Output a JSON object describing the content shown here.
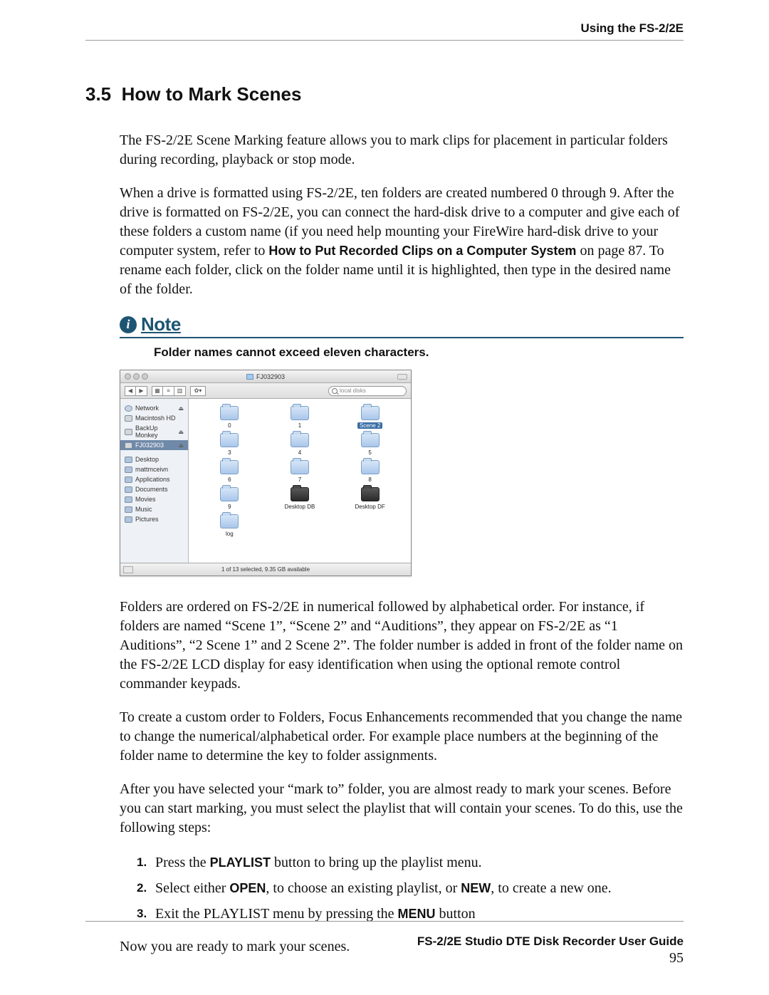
{
  "running_head": "Using the FS-2/2E",
  "section": {
    "number": "3.5",
    "title": "How to Mark Scenes"
  },
  "para1": "The FS-2/2E Scene Marking feature allows you to mark clips for placement in particular folders during recording, playback or stop mode.",
  "para2a": "When a drive is formatted using FS-2/2E, ten folders are created numbered 0 through 9. After the drive is formatted on FS-2/2E, you can connect the hard-disk drive to a computer and give each of these folders a custom name (if you need help mounting your FireWire hard-disk drive to your computer system, refer to ",
  "para2b_bold": "How to Put Recorded Clips on a Computer System",
  "para2c": " on page 87. To rename each folder, click on the folder name until it is highlighted, then type in the desired name of the folder.",
  "note": {
    "label": "Note",
    "text": "Folder names cannot exceed eleven characters."
  },
  "finder": {
    "title": "FJ032903",
    "search_placeholder": "local disks",
    "sidebar": [
      {
        "label": "Network",
        "kind": "network",
        "eject": "⏏"
      },
      {
        "label": "Macintosh HD",
        "kind": "hd"
      },
      {
        "label": "BackUp Monkey",
        "kind": "hd",
        "eject": "⏏"
      },
      {
        "label": "FJ032903",
        "kind": "hd",
        "selected": true,
        "eject": "⏏"
      },
      {
        "sep": true
      },
      {
        "label": "Desktop",
        "kind": "folder"
      },
      {
        "label": "mattmceivn",
        "kind": "home"
      },
      {
        "label": "Applications",
        "kind": "apps"
      },
      {
        "label": "Documents",
        "kind": "folder"
      },
      {
        "label": "Movies",
        "kind": "movies"
      },
      {
        "label": "Music",
        "kind": "music"
      },
      {
        "label": "Pictures",
        "kind": "pictures"
      }
    ],
    "items": [
      {
        "label": "0"
      },
      {
        "label": "1"
      },
      {
        "label": "Scene 2",
        "selected": true
      },
      {
        "label": "3"
      },
      {
        "label": "4"
      },
      {
        "label": "5"
      },
      {
        "label": "6"
      },
      {
        "label": "7"
      },
      {
        "label": "8"
      },
      {
        "label": "9"
      },
      {
        "label": "Desktop DB",
        "db": true
      },
      {
        "label": "Desktop DF",
        "db": true
      },
      {
        "label": "log"
      }
    ],
    "status": "1 of 13 selected, 9.35 GB available"
  },
  "para3": "Folders are ordered on FS-2/2E in numerical followed by alphabetical order. For instance, if folders are named “Scene 1”, “Scene 2” and “Auditions”, they appear on FS-2/2E as “1 Auditions”, “2 Scene 1” and 2 Scene 2”. The folder number is added in front of the folder name on the FS-2/2E LCD display for easy identification when using the optional remote control commander keypads.",
  "para4": "To create a custom order to Folders, Focus Enhancements recommended that you change the name to change the numerical/alphabetical order. For example place numbers at the beginning of the folder name to determine the key to folder assignments.",
  "para5": "After you have selected your “mark to” folder, you are almost ready to mark your scenes. Before you can start marking, you must select the playlist that will contain your scenes. To do this, use the following steps:",
  "steps": [
    {
      "n": "1.",
      "a": "Press the ",
      "b": "PLAYLIST",
      "c": " button to bring up the playlist menu."
    },
    {
      "n": "2.",
      "a": "Select either ",
      "b": "OPEN",
      "c": ", to choose an existing playlist, or ",
      "d": "NEW",
      "e": ", to create a new one."
    },
    {
      "n": "3.",
      "a": "Exit the PLAYLIST menu by pressing the ",
      "b": "MENU",
      "c": " button"
    }
  ],
  "para6": "Now you are ready to mark your scenes.",
  "footer": {
    "line1": "FS-2/2E Studio DTE Disk Recorder User Guide",
    "page": "95"
  }
}
